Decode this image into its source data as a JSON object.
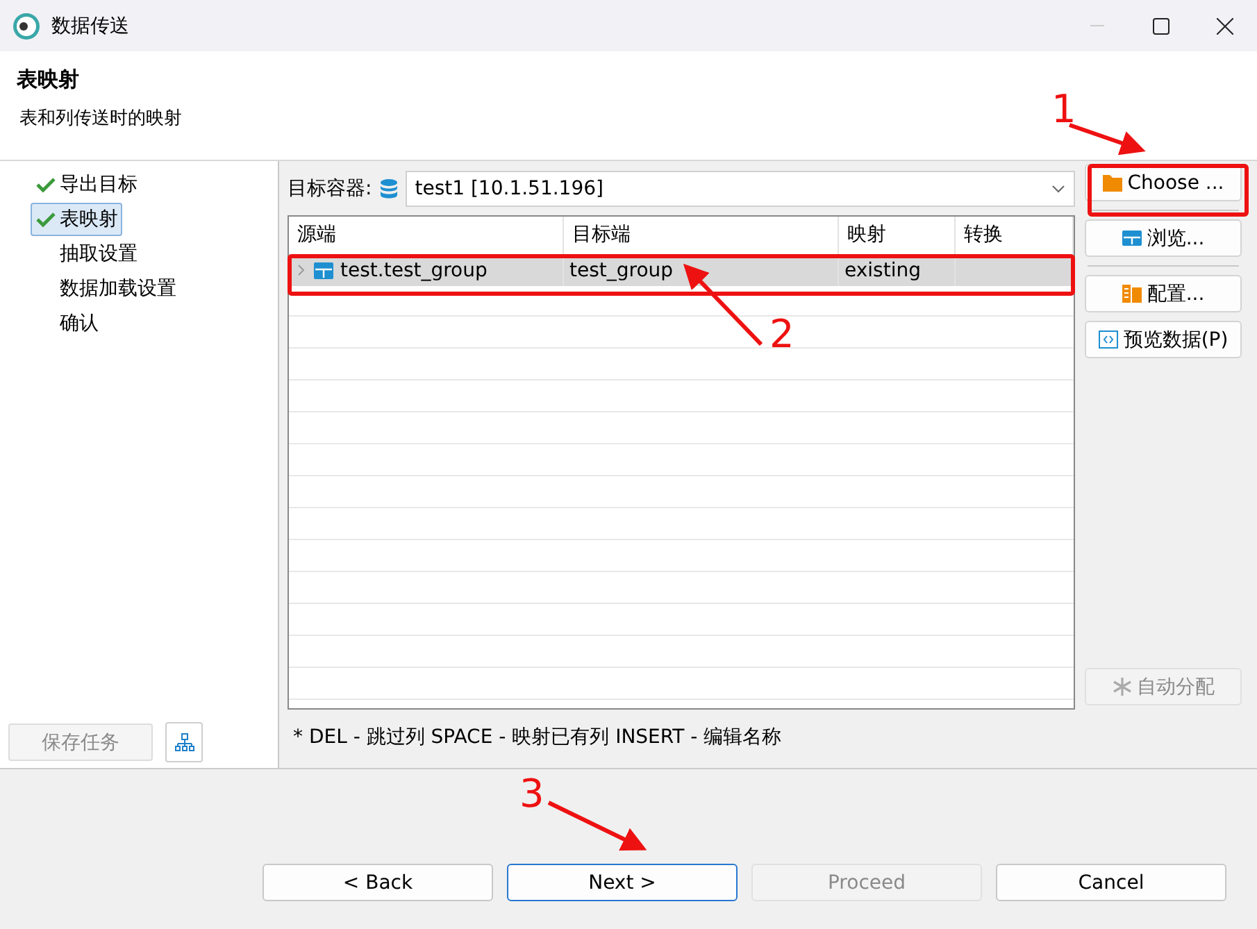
{
  "window": {
    "title": "数据传送"
  },
  "header": {
    "title": "表映射",
    "subtitle": "表和列传送时的映射"
  },
  "nav": {
    "items": [
      {
        "label": "导出目标",
        "checked": true,
        "selected": false
      },
      {
        "label": "表映射",
        "checked": true,
        "selected": true
      },
      {
        "label": "抽取设置",
        "checked": false,
        "selected": false
      },
      {
        "label": "数据加载设置",
        "checked": false,
        "selected": false
      },
      {
        "label": "确认",
        "checked": false,
        "selected": false
      }
    ],
    "save_button": {
      "label": "保存任务",
      "disabled": true
    }
  },
  "target": {
    "label": "目标容器:",
    "value": "test1  [10.1.51.196]"
  },
  "table": {
    "columns": [
      "源端",
      "目标端",
      "映射",
      "转换"
    ],
    "rows": [
      {
        "cells": [
          "test.test_group",
          "test_group",
          "existing",
          ""
        ],
        "selected": true
      }
    ]
  },
  "side_buttons": [
    {
      "label": "Choose ...",
      "kind": "folder",
      "disabled": false
    },
    {
      "label": "浏览...",
      "kind": "table",
      "disabled": false
    },
    {
      "label": "配置...",
      "kind": "config",
      "disabled": false
    },
    {
      "label": "预览数据(P)",
      "kind": "preview",
      "disabled": false
    },
    {
      "label": "自动分配",
      "kind": "auto",
      "disabled": true
    }
  ],
  "hint": "* DEL - 跳过列  SPACE - 映射已有列  INSERT - 编辑名称",
  "footer_buttons": [
    {
      "label": "< Back",
      "disabled": false,
      "focused": false
    },
    {
      "label": "Next >",
      "disabled": false,
      "focused": true
    },
    {
      "label": "Proceed",
      "disabled": true,
      "focused": false
    },
    {
      "label": "Cancel",
      "disabled": false,
      "focused": false
    }
  ],
  "annotations": [
    {
      "label": "1"
    },
    {
      "label": "2"
    },
    {
      "label": "3"
    }
  ]
}
